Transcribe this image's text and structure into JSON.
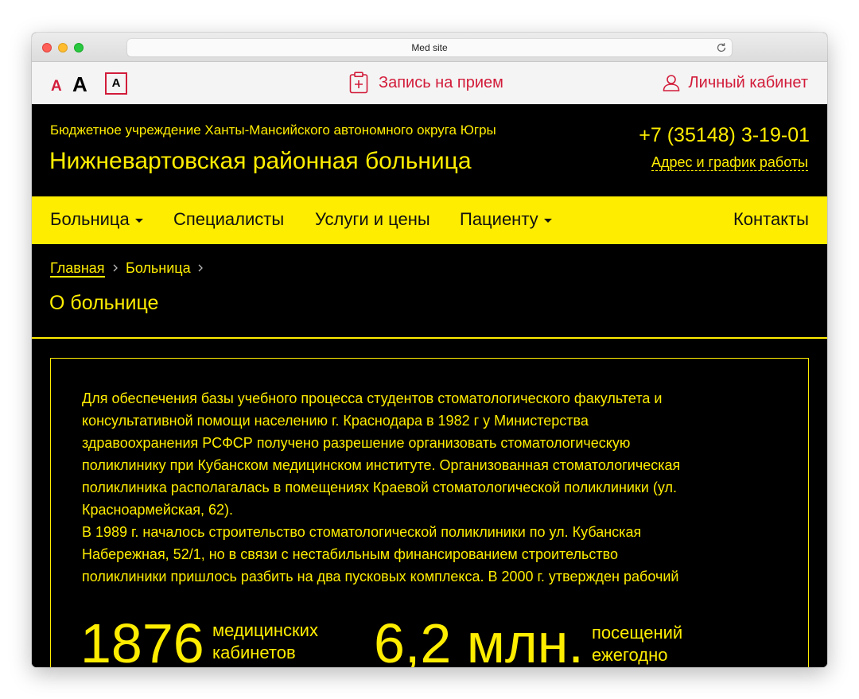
{
  "browser": {
    "url_title": "Med site"
  },
  "accessibility": {
    "font_small": "A",
    "font_large": "A",
    "contrast": "A"
  },
  "topbar": {
    "appointment_label": "Запись на прием",
    "cabinet_label": "Личный кабинет"
  },
  "header": {
    "org_subtitle": "Бюджетное учреждение Ханты-Мансийского автономного округа Югры",
    "org_name": "Нижневартовская районная больница",
    "phone": "+7 (35148) 3-19-01",
    "address_link": "Адрес и график работы"
  },
  "nav": {
    "items": [
      {
        "label": "Больница",
        "dropdown": true
      },
      {
        "label": "Специалисты",
        "dropdown": false
      },
      {
        "label": "Услуги и цены",
        "dropdown": false
      },
      {
        "label": "Пациенту",
        "dropdown": true
      },
      {
        "label": "Контакты",
        "dropdown": false
      }
    ]
  },
  "breadcrumbs": {
    "items": [
      "Главная",
      "Больница"
    ]
  },
  "page": {
    "title": "О больнице",
    "paragraph_1_lines": [
      "Для обеспечения базы учебного процесса студентов стоматологического факультета и",
      "консультативной помощи населению г. Краснодара в 1982 г у Министерства",
      "здравоохранения РСФСР получено разрешение организовать стоматологическую",
      "поликлинику при Кубанском медицинском институте. Организованная стоматологическая",
      "поликлиника располагалась в помещениях Краевой стоматологической поликлиники (ул.",
      "Красноармейская, 62)."
    ],
    "paragraph_2_lines": [
      "В 1989 г. началось строительство стоматологической поликлиники по ул. Кубанская",
      "Набережная, 52/1, но в связи с нестабильным финансированием строительство",
      "поликлиники пришлось разбить на два пусковых комплекса. В 2000 г. утвержден рабочий"
    ],
    "stats": [
      {
        "value": "1876",
        "label_line1": "медицинских",
        "label_line2": "кабинетов"
      },
      {
        "value": "6,2 млн.",
        "label_line1": "посещений",
        "label_line2": "ежегодно"
      }
    ]
  },
  "colors": {
    "accent_yellow": "#ffed00",
    "accent_red": "#d21c3a",
    "background": "#000000"
  }
}
